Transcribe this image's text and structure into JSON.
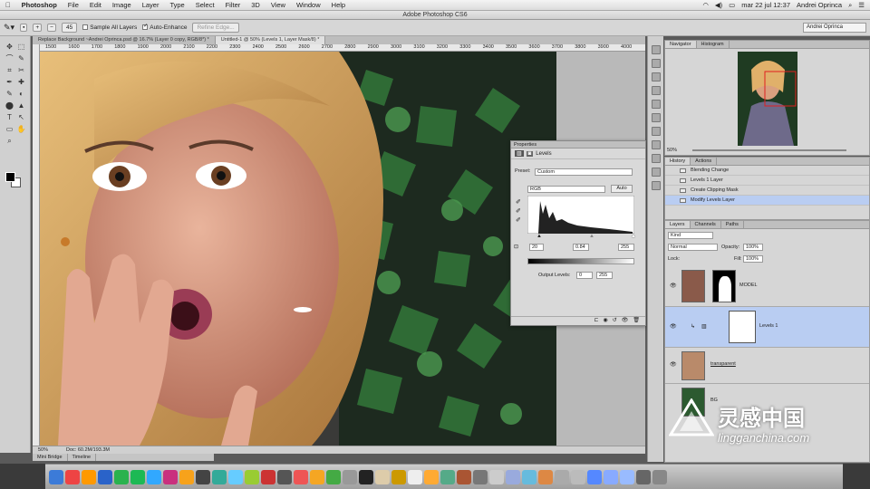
{
  "menubar": {
    "apple": "",
    "app": "Photoshop",
    "items": [
      "File",
      "Edit",
      "Image",
      "Layer",
      "Type",
      "Select",
      "Filter",
      "3D",
      "View",
      "Window",
      "Help"
    ],
    "datetime": "mar 22 jul  12:37",
    "user": "Andrei Oprinca"
  },
  "window_title": "Adobe Photoshop CS6",
  "options": {
    "brush_size": "45",
    "sample_all": "Sample All Layers",
    "auto_enhance": "Auto-Enhance",
    "refine_edge": "Refine Edge...",
    "workspace": "Andrei Oprinca"
  },
  "tabs": [
    "Replace Background ~Andrei Oprinca.psd @ 16.7% (Layer 0 copy, RGB/8*) *",
    "Untitled-1 @ 50% (Levels 1, Layer Mask/8) *"
  ],
  "ruler_ticks": [
    "1500",
    "1600",
    "1700",
    "1800",
    "1900",
    "2000",
    "2100",
    "2200",
    "2300",
    "2400",
    "2500",
    "2600",
    "2700",
    "2800",
    "2900",
    "3000",
    "3100",
    "3200",
    "3300",
    "3400",
    "3500",
    "3600",
    "3700",
    "3800",
    "3900",
    "4000"
  ],
  "status": {
    "zoom": "50%",
    "doc": "Doc: 60.2M/193.3M"
  },
  "bottom_tabs": [
    "Mini Bridge",
    "Timeline"
  ],
  "navigator": {
    "tabs": [
      "Navigator",
      "Histogram"
    ],
    "zoom": "50%"
  },
  "history": {
    "tabs": [
      "History",
      "Actions"
    ],
    "items": [
      "Blending Change",
      "Levels 1 Layer",
      "Create Clipping Mask",
      "Modify Levels Layer"
    ]
  },
  "layers": {
    "tabs": [
      "Layers",
      "Channels",
      "Paths"
    ],
    "kind": "Kind",
    "blend": "Normal",
    "opacity_label": "Opacity:",
    "opacity": "100%",
    "lock_label": "Lock:",
    "fill_label": "Fill:",
    "fill": "100%",
    "rows": [
      {
        "name": "MODEL"
      },
      {
        "name": "Levels 1"
      },
      {
        "name": "transparent"
      },
      {
        "name": "BG"
      }
    ]
  },
  "properties": {
    "title": "Properties",
    "panel": "Levels",
    "preset_label": "Preset:",
    "preset": "Custom",
    "channel": "RGB",
    "auto": "Auto",
    "input_black": "20",
    "input_gamma": "0.84",
    "input_white": "255",
    "output_label": "Output Levels:",
    "output_black": "0",
    "output_white": "255"
  },
  "watermark": {
    "name": "灵感中国",
    "url": "lingganchina.com"
  },
  "colors": {
    "accent": "#b9cdf2",
    "panel": "#d6d6d6"
  }
}
